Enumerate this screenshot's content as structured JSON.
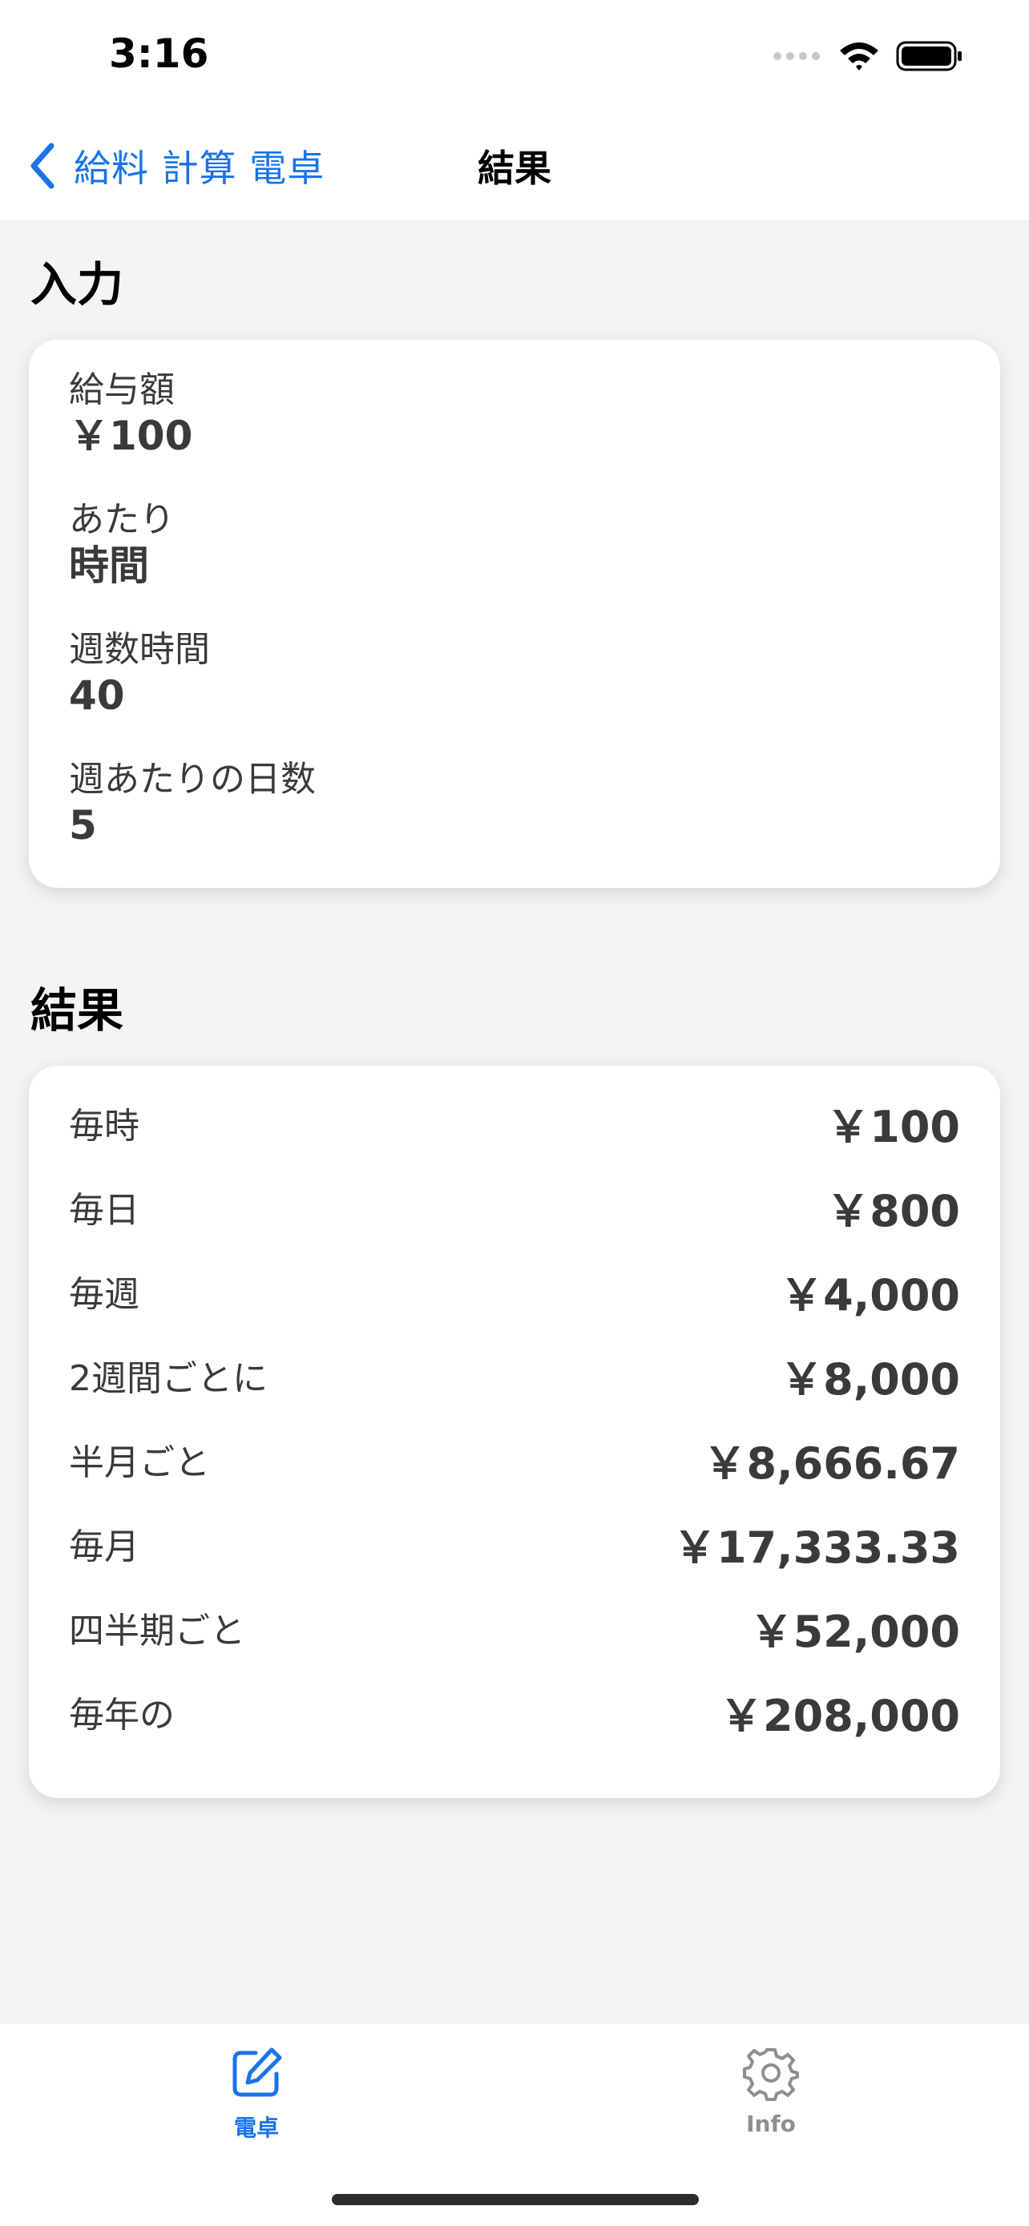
{
  "status_bar": {
    "time": "3:16"
  },
  "nav": {
    "back_label": "給料 計算 電卓",
    "title": "結果"
  },
  "input_section": {
    "title": "入力",
    "fields": [
      {
        "label": "給与額",
        "value": "￥100"
      },
      {
        "label": "あたり",
        "value": "時間"
      },
      {
        "label": "週数時間",
        "value": "40"
      },
      {
        "label": "週あたりの日数",
        "value": "5"
      }
    ]
  },
  "result_section": {
    "title": "結果",
    "rows": [
      {
        "label": "毎時",
        "value": "￥100"
      },
      {
        "label": "毎日",
        "value": "￥800"
      },
      {
        "label": "毎週",
        "value": "￥4,000"
      },
      {
        "label": "2週間ごとに",
        "value": "￥8,000"
      },
      {
        "label": "半月ごと",
        "value": "￥8,666.67"
      },
      {
        "label": "毎月",
        "value": "￥17,333.33"
      },
      {
        "label": "四半期ごと",
        "value": "￥52,000"
      },
      {
        "label": "毎年の",
        "value": "￥208,000"
      }
    ]
  },
  "tab_bar": {
    "tabs": [
      {
        "label": "電卓",
        "icon": "edit-icon",
        "active": true
      },
      {
        "label": "Info",
        "icon": "gear-icon",
        "active": false
      }
    ]
  },
  "colors": {
    "accent": "#1a73e8",
    "inactive": "#8e8e93",
    "background": "#f4f4f5"
  }
}
